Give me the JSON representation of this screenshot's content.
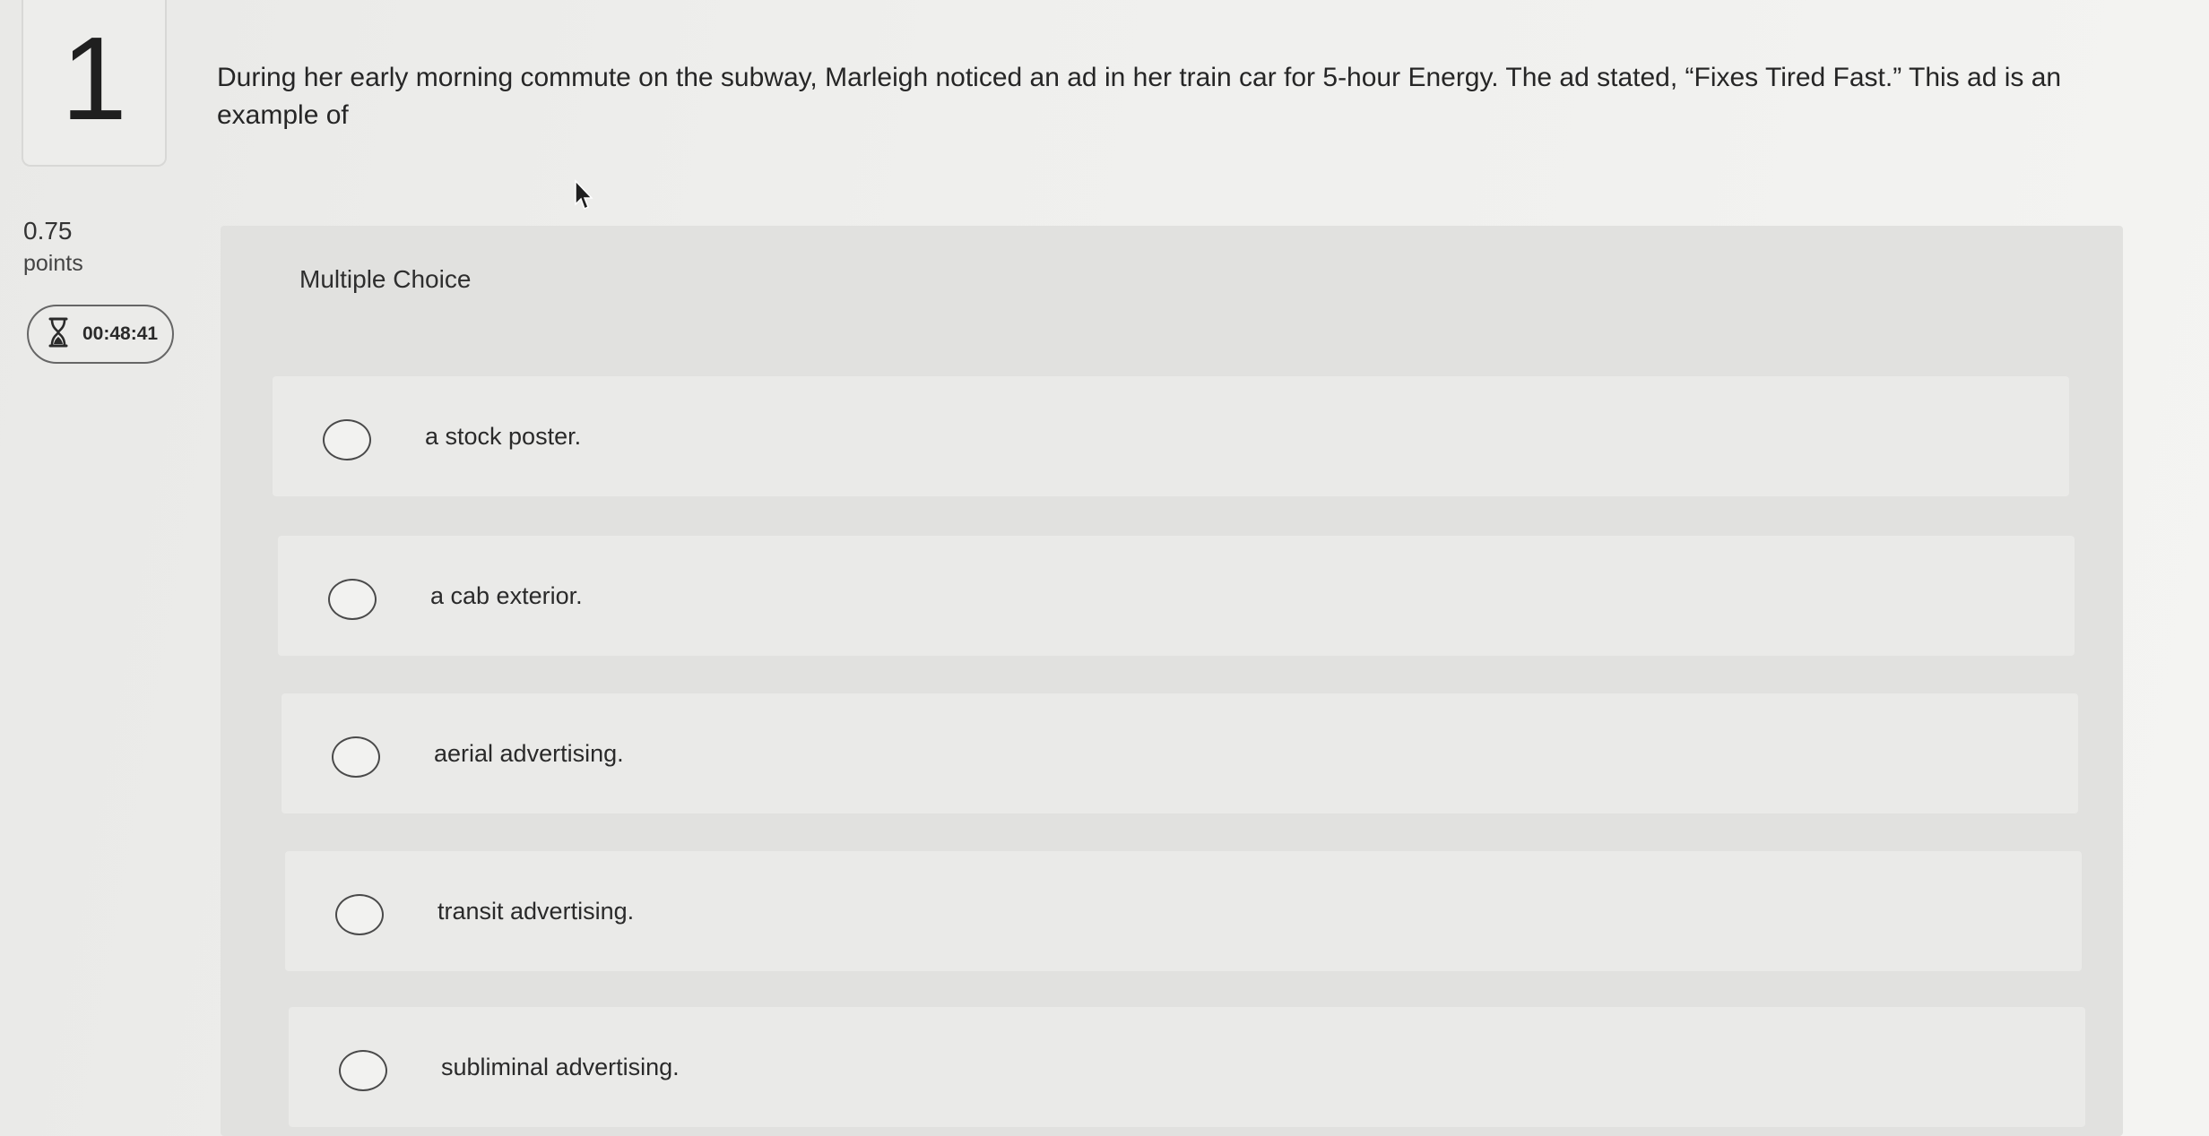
{
  "question": {
    "number": "1",
    "points_value": "0.75",
    "points_label": "points",
    "timer": "00:48:41",
    "text": "During her early morning commute on the subway, Marleigh noticed an ad in her train car for 5-hour Energy. The ad stated, “Fixes Tired Fast.” This ad is an example of"
  },
  "answer_panel": {
    "title": "Multiple Choice",
    "options": [
      {
        "label": "a stock poster."
      },
      {
        "label": "a cab exterior."
      },
      {
        "label": "aerial advertising."
      },
      {
        "label": "transit advertising."
      },
      {
        "label": "subliminal advertising."
      }
    ]
  },
  "icons": {
    "timer": "hourglass-icon",
    "pointer": "mouse-cursor-icon"
  }
}
